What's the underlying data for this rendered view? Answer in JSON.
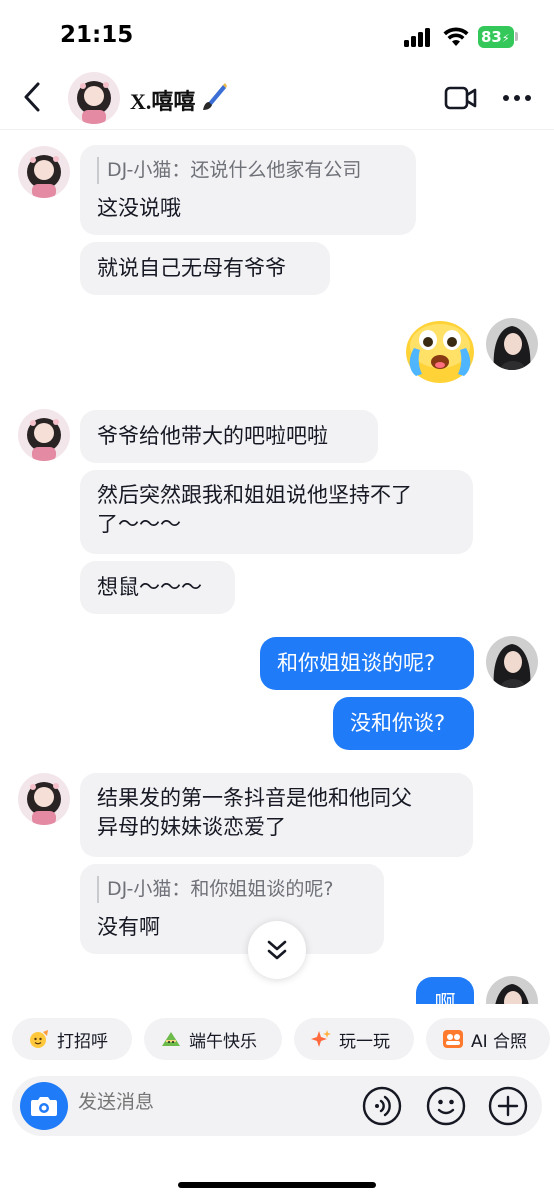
{
  "status": {
    "time": "21:15",
    "battery": "83"
  },
  "header": {
    "name": "X.嘻嘻"
  },
  "messages": {
    "m1_quote": "DJ-小猫：还说什么他家有公司",
    "m1_text": "这没说哦",
    "m2": "就说自己无母有爷爷",
    "m4": "爷爷给他带大的吧啦吧啦",
    "m5_line1": "然后突然跟我和姐姐说他坚持不了",
    "m5_line2": "了～～～",
    "m6": "想鼠～～～",
    "m7": "和你姐姐谈的呢?",
    "m8": "没和你谈?",
    "m9_line1": "结果发的第一条抖音是他和他同父",
    "m9_line2": "异母的妹妹谈恋爱了",
    "m10_quote": "DJ-小猫：和你姐姐谈的呢?",
    "m10_text": "没有啊",
    "m11": "啊"
  },
  "quick_actions": [
    {
      "label": "打招呼",
      "icon": "wave-emoji-icon"
    },
    {
      "label": "端午快乐",
      "icon": "zongzi-icon"
    },
    {
      "label": "玩一玩",
      "icon": "sparkle-icon"
    },
    {
      "label": "AI 合照",
      "icon": "ai-photo-icon"
    }
  ],
  "composer": {
    "placeholder": "发送消息"
  },
  "colors": {
    "accent": "#1f7bf7",
    "incoming_bubble": "#f2f2f4",
    "battery": "#34c759"
  }
}
